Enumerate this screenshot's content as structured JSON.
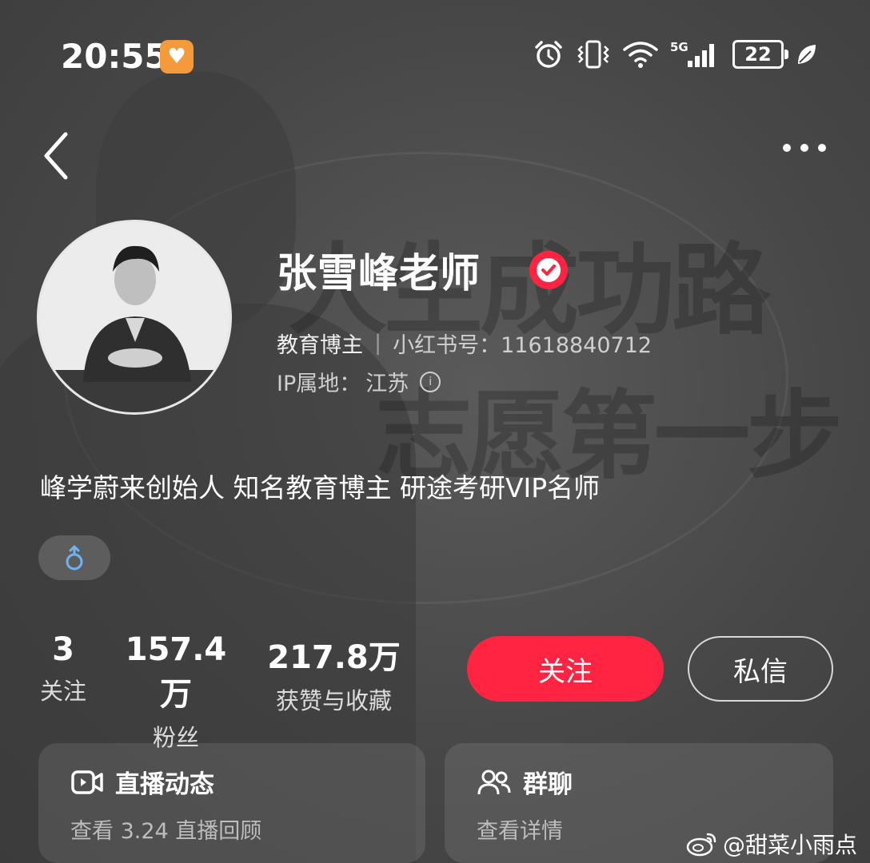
{
  "status_bar": {
    "time": "20:55",
    "app_icon": "heart-app-icon",
    "icons": [
      "alarm-icon",
      "vibrate-icon",
      "wifi-icon",
      "5g-signal-icon"
    ],
    "network": "5G",
    "battery": "22",
    "extra_icon": "leaf-icon"
  },
  "nav": {
    "back_icon": "chevron-left-icon",
    "more_icon": "more-dots-icon"
  },
  "background": {
    "poster_line_1": "人生成功路",
    "poster_line_2": "志愿第一步"
  },
  "profile": {
    "name": "张雪峰老师",
    "verified_icon": "verified-check-icon",
    "role": "教育博主",
    "separator": "|",
    "id_label": "小红书号：",
    "id_value": "11618840712",
    "ip_label": "IP属地：",
    "ip_value": "江苏",
    "bio": "峰学蔚来创始人 知名教育博主 研途考研VIP名师",
    "gender_icon": "male-icon"
  },
  "stats": [
    {
      "value": "3",
      "label": "关注"
    },
    {
      "value": "157.4万",
      "label": "粉丝"
    },
    {
      "value": "217.8万",
      "label": "获赞与收藏"
    }
  ],
  "buttons": {
    "follow": "关注",
    "message": "私信"
  },
  "cards": [
    {
      "title": "直播动态",
      "subtitle": "查看 3.24 直播回顾",
      "icon": "live-video-icon"
    },
    {
      "title": "群聊",
      "subtitle": "查看详情",
      "icon": "group-chat-icon"
    }
  ],
  "watermark": {
    "text": "@甜菜小雨点",
    "icon": "weibo-icon"
  },
  "colors": {
    "accent": "#ff2442",
    "background": "#4a4a4a",
    "app_badge": "#f59a3a"
  }
}
